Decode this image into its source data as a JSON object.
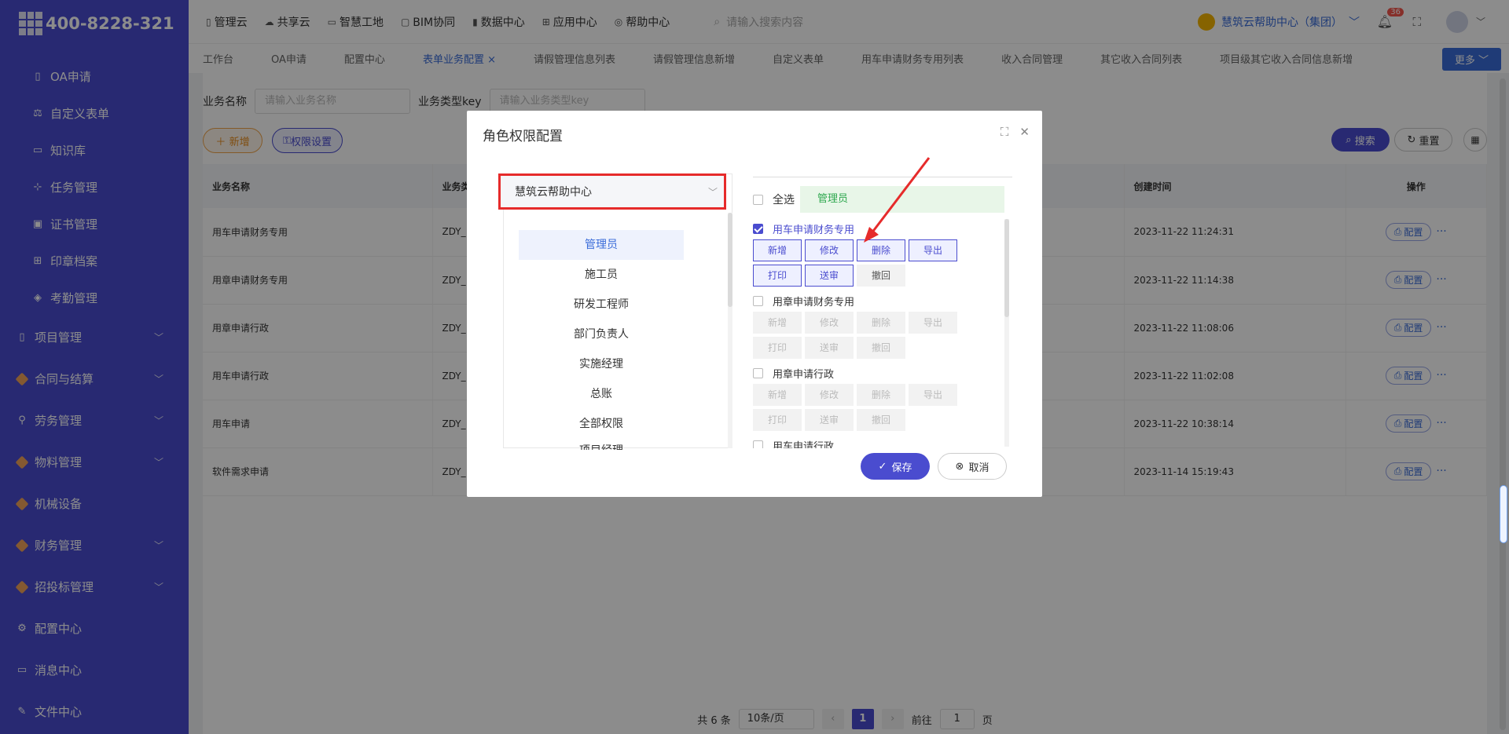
{
  "logo": {
    "phone": "400-8228-321"
  },
  "sidebar": {
    "items": [
      {
        "label": "OA申请",
        "icon": "document-icon"
      },
      {
        "label": "自定义表单",
        "icon": "adjust-icon"
      },
      {
        "label": "知识库",
        "icon": "book-icon"
      },
      {
        "label": "任务管理",
        "icon": "hierarchy-icon"
      },
      {
        "label": "证书管理",
        "icon": "certificate-icon"
      },
      {
        "label": "印章档案",
        "icon": "grid-icon"
      },
      {
        "label": "考勤管理",
        "icon": "tag-icon"
      }
    ],
    "groups": [
      {
        "label": "项目管理"
      },
      {
        "label": "合同与结算"
      },
      {
        "label": "劳务管理"
      },
      {
        "label": "物料管理"
      },
      {
        "label": "机械设备"
      },
      {
        "label": "财务管理"
      },
      {
        "label": "招投标管理"
      },
      {
        "label": "配置中心"
      },
      {
        "label": "消息中心"
      },
      {
        "label": "文件中心"
      }
    ]
  },
  "topnav": {
    "items": [
      "管理云",
      "共享云",
      "智慧工地",
      "BIM协同",
      "数据中心",
      "应用中心",
      "帮助中心"
    ],
    "search_placeholder": "请输入搜索内容",
    "user": "慧筑云帮助中心（集团）",
    "badge": "36"
  },
  "tabs": [
    "工作台",
    "OA申请",
    "配置中心",
    "表单业务配置",
    "请假管理信息列表",
    "请假管理信息新增",
    "自定义表单",
    "用车申请财务专用列表",
    "收入合同管理",
    "其它收入合同列表",
    "项目级其它收入合同信息新增"
  ],
  "tabs_more": "更多",
  "filter": {
    "name_label": "业务名称",
    "name_placeholder": "请输入业务名称",
    "key_label": "业务类型key",
    "key_placeholder": "请输入业务类型key"
  },
  "actions": {
    "new": "新增",
    "perm": "权限设置",
    "search": "搜索",
    "reset": "重置"
  },
  "table": {
    "headers": [
      "业务名称",
      "业务类",
      "创建时间",
      "操作"
    ],
    "rows": [
      {
        "name": "用车申请财务专用",
        "key": "ZDY_",
        "time": "2023-11-22 11:24:31"
      },
      {
        "name": "用章申请财务专用",
        "key": "ZDY_",
        "time": "2023-11-22 11:14:38"
      },
      {
        "name": "用章申请行政",
        "key": "ZDY_",
        "time": "2023-11-22 11:08:06"
      },
      {
        "name": "用车申请行政",
        "key": "ZDY_",
        "time": "2023-11-22 11:02:08"
      },
      {
        "name": "用车申请",
        "key": "ZDY_",
        "time": "2023-11-22 10:38:14"
      },
      {
        "name": "软件需求申请",
        "key": "ZDY_",
        "time": "2023-11-14 15:19:43"
      }
    ],
    "op_label": "配置"
  },
  "pager": {
    "total": "共 6 条",
    "size": "10条/页",
    "current": "1",
    "goto_label": "前往",
    "goto_value": "1",
    "page_unit": "页"
  },
  "modal": {
    "title": "角色权限配置",
    "org": "慧筑云帮助中心",
    "roles": [
      "管理员",
      "施工员",
      "研发工程师",
      "部门负责人",
      "实施经理",
      "总账",
      "全部权限",
      "项目经理"
    ],
    "select_all": "全选",
    "current_role": "管理员",
    "groups": [
      {
        "title": "用车申请财务专用",
        "checked": true
      },
      {
        "title": "用章申请财务专用",
        "checked": false
      },
      {
        "title": "用章申请行政",
        "checked": false
      },
      {
        "title": "用车申请行政",
        "checked": false
      }
    ],
    "perm_labels": [
      "新增",
      "修改",
      "删除",
      "导出",
      "打印",
      "送审",
      "撤回"
    ],
    "save": "保存",
    "cancel": "取消"
  }
}
